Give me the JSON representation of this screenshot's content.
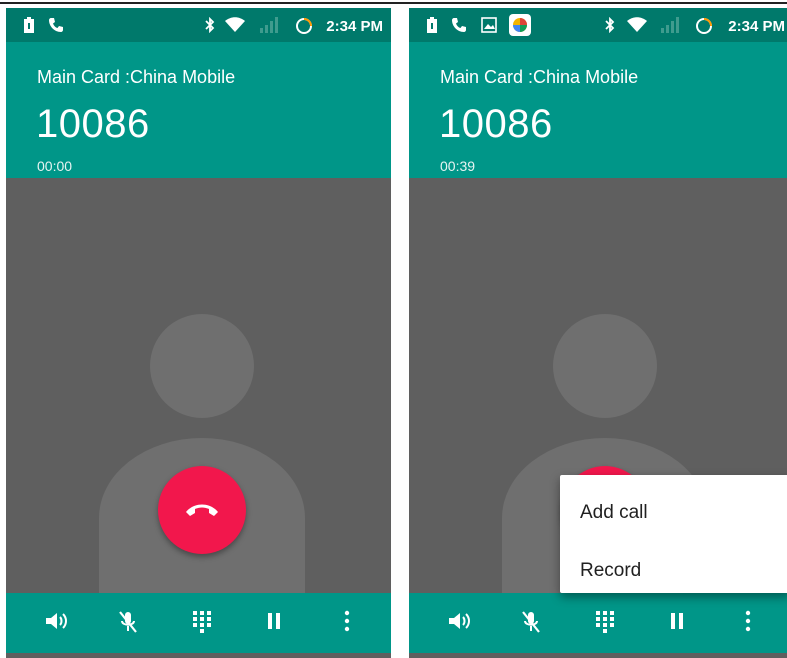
{
  "status_bar": {
    "time": "2:34 PM"
  },
  "screens": [
    {
      "header": {
        "card_label": "Main Card :China Mobile",
        "number": "10086",
        "timer": "00:00"
      }
    },
    {
      "header": {
        "card_label": "Main Card :China Mobile",
        "number": "10086",
        "timer": "00:39"
      },
      "overflow_menu": {
        "items": [
          "Add call",
          "Record"
        ]
      }
    }
  ],
  "colors": {
    "status_bar": "#00796b",
    "header": "#009688",
    "background": "#5f5f5f",
    "avatar": "#6f6f6f",
    "end_call": "#f2174c",
    "menu": "#ffffff"
  },
  "icons": {
    "status": [
      "battery-icon",
      "phone-icon",
      "bluetooth-icon",
      "wifi-icon",
      "signal-icon",
      "sync-icon"
    ],
    "status_right_screen_extra": [
      "image-icon",
      "app-icon"
    ],
    "controls": [
      "speaker-icon",
      "mute-icon",
      "dialpad-icon",
      "hold-icon",
      "more-vert-icon"
    ],
    "end_call": "end-call-icon"
  }
}
